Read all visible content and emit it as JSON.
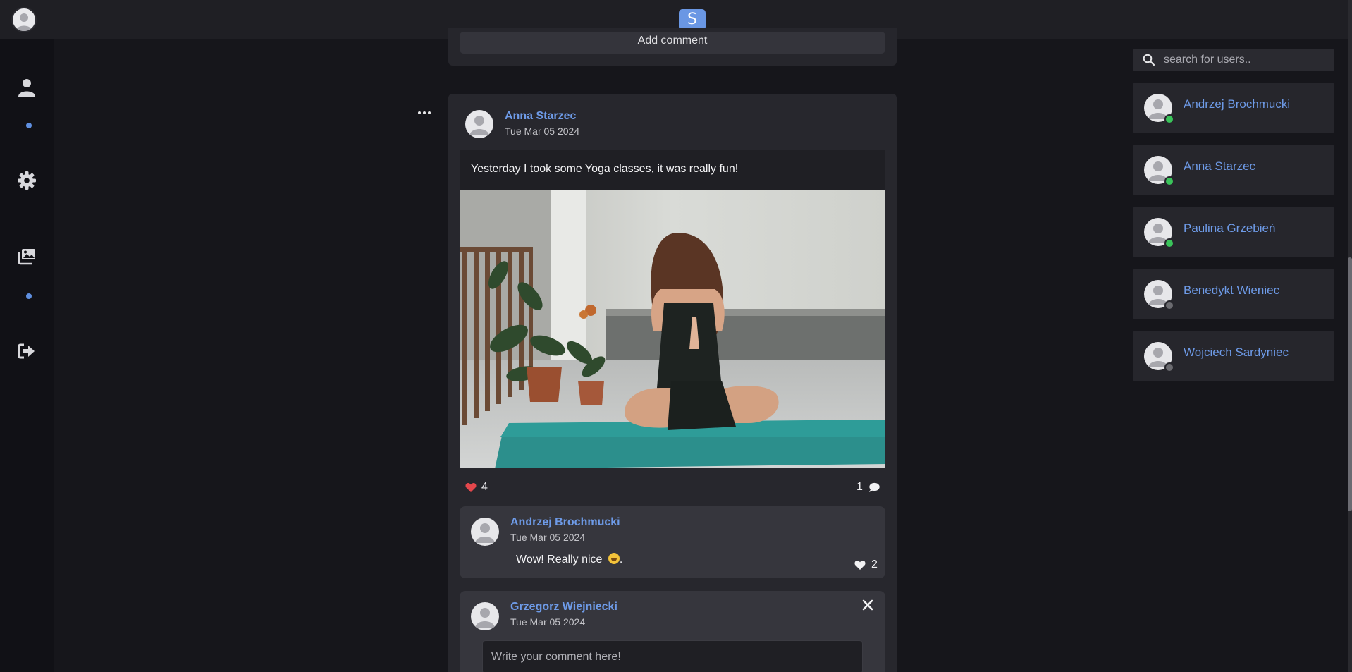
{
  "app": {
    "logo_letter": "S",
    "accent_color": "#6a97e4",
    "online_color": "#3ac35a",
    "offline_color": "#6b6b70"
  },
  "sidebar": {
    "items": [
      {
        "icon": "user-icon"
      },
      {
        "icon": "gear-icon"
      },
      {
        "icon": "images-icon"
      },
      {
        "icon": "logout-icon"
      }
    ]
  },
  "previous_post": {
    "add_comment_label": "Add comment"
  },
  "post": {
    "author": "Anna Starzec",
    "date": "Tue Mar 05 2024",
    "text": "Yesterday I took some Yoga classes, it was really fun!",
    "likes": "4",
    "comments_count": "1",
    "image_alt": "Woman doing yoga on a teal mat on a balcony"
  },
  "comments": [
    {
      "author": "Andrzej Brochmucki",
      "date": "Tue Mar 05 2024",
      "text": "Wow! Really nice ",
      "text_end": ".",
      "likes": "2"
    }
  ],
  "new_comment": {
    "author": "Grzegorz Wiejniecki",
    "date": "Tue Mar 05 2024",
    "placeholder": "Write your comment here!"
  },
  "search": {
    "placeholder": "search for users.."
  },
  "users": [
    {
      "name": "Andrzej Brochmucki",
      "status": "online"
    },
    {
      "name": "Anna Starzec",
      "status": "online"
    },
    {
      "name": "Paulina Grzebień",
      "status": "online"
    },
    {
      "name": "Benedykt Wieniec",
      "status": "offline"
    },
    {
      "name": "Wojciech Sardyniec",
      "status": "offline"
    }
  ]
}
